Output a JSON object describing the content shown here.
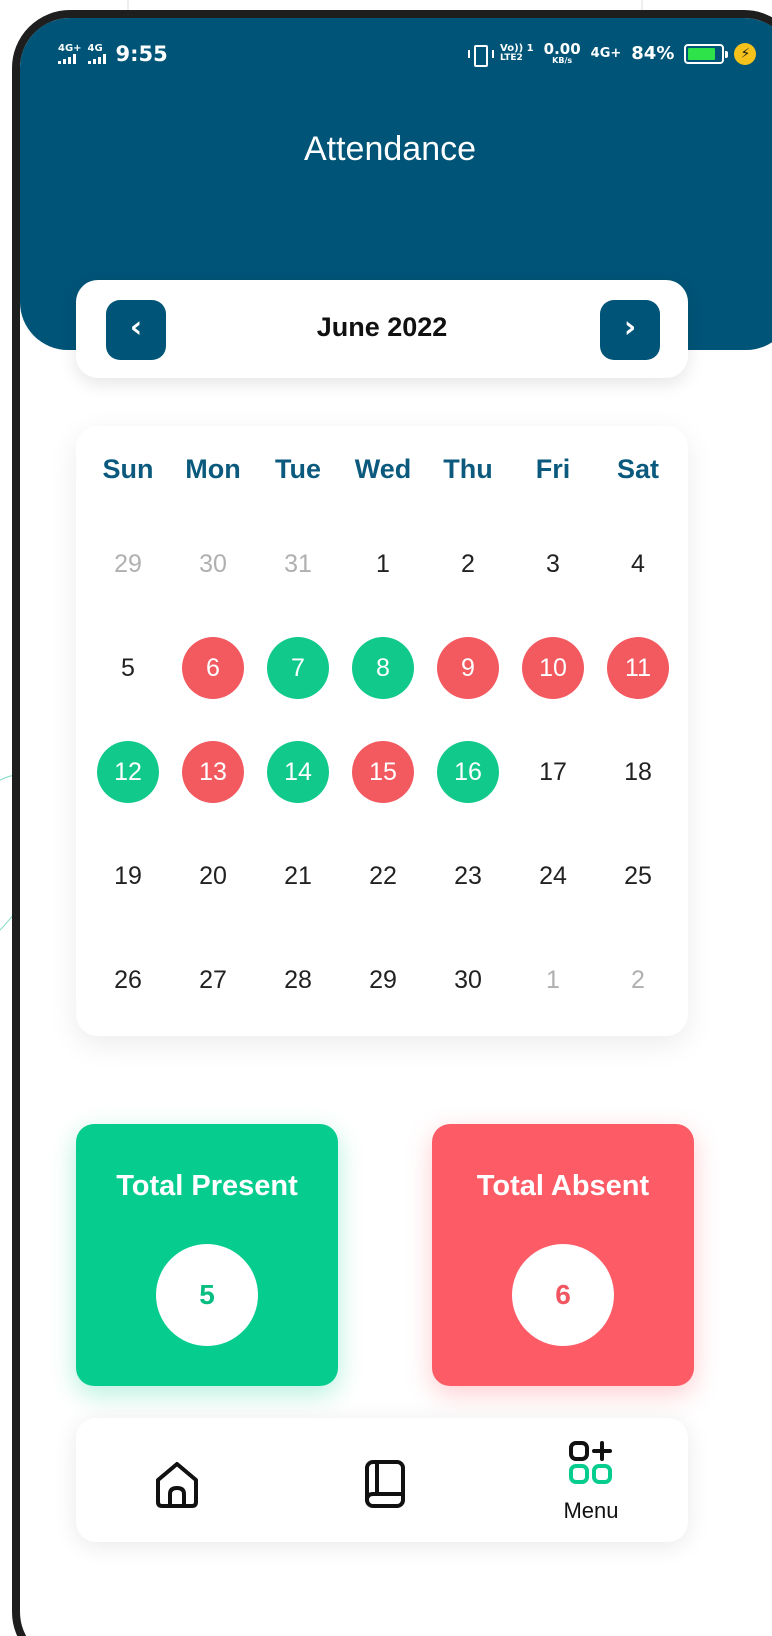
{
  "status_bar": {
    "net1": "4G+",
    "net2": "4G",
    "time": "9:55",
    "volte_top": "Vo)) 1",
    "volte_bottom": "LTE2",
    "speed_value": "0.00",
    "speed_unit": "KB/s",
    "net3": "4G+",
    "battery": "84%",
    "battery_level": 0.84,
    "icons": [
      "signal-icon",
      "vibrate-icon",
      "battery-icon",
      "charging-icon"
    ]
  },
  "header": {
    "title": "Attendance",
    "color": "#005477"
  },
  "month_nav": {
    "prev_icon": "chevron-left-icon",
    "next_icon": "chevron-right-icon",
    "prev_symbol": "‹",
    "next_symbol": "›",
    "month": "June 2022"
  },
  "calendar": {
    "weekdays": [
      "Sun",
      "Mon",
      "Tue",
      "Wed",
      "Thu",
      "Fri",
      "Sat"
    ],
    "weeks": [
      [
        {
          "d": "29",
          "s": "muted"
        },
        {
          "d": "30",
          "s": "muted"
        },
        {
          "d": "31",
          "s": "muted"
        },
        {
          "d": "1",
          "s": ""
        },
        {
          "d": "2",
          "s": ""
        },
        {
          "d": "3",
          "s": ""
        },
        {
          "d": "4",
          "s": ""
        }
      ],
      [
        {
          "d": "5",
          "s": ""
        },
        {
          "d": "6",
          "s": "absent"
        },
        {
          "d": "7",
          "s": "present"
        },
        {
          "d": "8",
          "s": "present"
        },
        {
          "d": "9",
          "s": "absent"
        },
        {
          "d": "10",
          "s": "absent"
        },
        {
          "d": "11",
          "s": "absent"
        }
      ],
      [
        {
          "d": "12",
          "s": "present"
        },
        {
          "d": "13",
          "s": "absent"
        },
        {
          "d": "14",
          "s": "present"
        },
        {
          "d": "15",
          "s": "absent"
        },
        {
          "d": "16",
          "s": "present"
        },
        {
          "d": "17",
          "s": ""
        },
        {
          "d": "18",
          "s": ""
        }
      ],
      [
        {
          "d": "19",
          "s": ""
        },
        {
          "d": "20",
          "s": ""
        },
        {
          "d": "21",
          "s": ""
        },
        {
          "d": "22",
          "s": ""
        },
        {
          "d": "23",
          "s": ""
        },
        {
          "d": "24",
          "s": ""
        },
        {
          "d": "25",
          "s": ""
        }
      ],
      [
        {
          "d": "26",
          "s": ""
        },
        {
          "d": "27",
          "s": ""
        },
        {
          "d": "28",
          "s": ""
        },
        {
          "d": "29",
          "s": ""
        },
        {
          "d": "30",
          "s": ""
        },
        {
          "d": "1",
          "s": "muted"
        },
        {
          "d": "2",
          "s": "muted"
        }
      ]
    ],
    "colors": {
      "present": "#10c98a",
      "absent": "#f25a60"
    }
  },
  "stats": {
    "present_label": "Total Present",
    "present_value": "5",
    "absent_label": "Total Absent",
    "absent_value": "6"
  },
  "bottom_nav": {
    "items": [
      {
        "icon": "home-icon",
        "label": ""
      },
      {
        "icon": "book-icon",
        "label": ""
      },
      {
        "icon": "menu-grid-icon",
        "label": "Menu"
      }
    ]
  }
}
